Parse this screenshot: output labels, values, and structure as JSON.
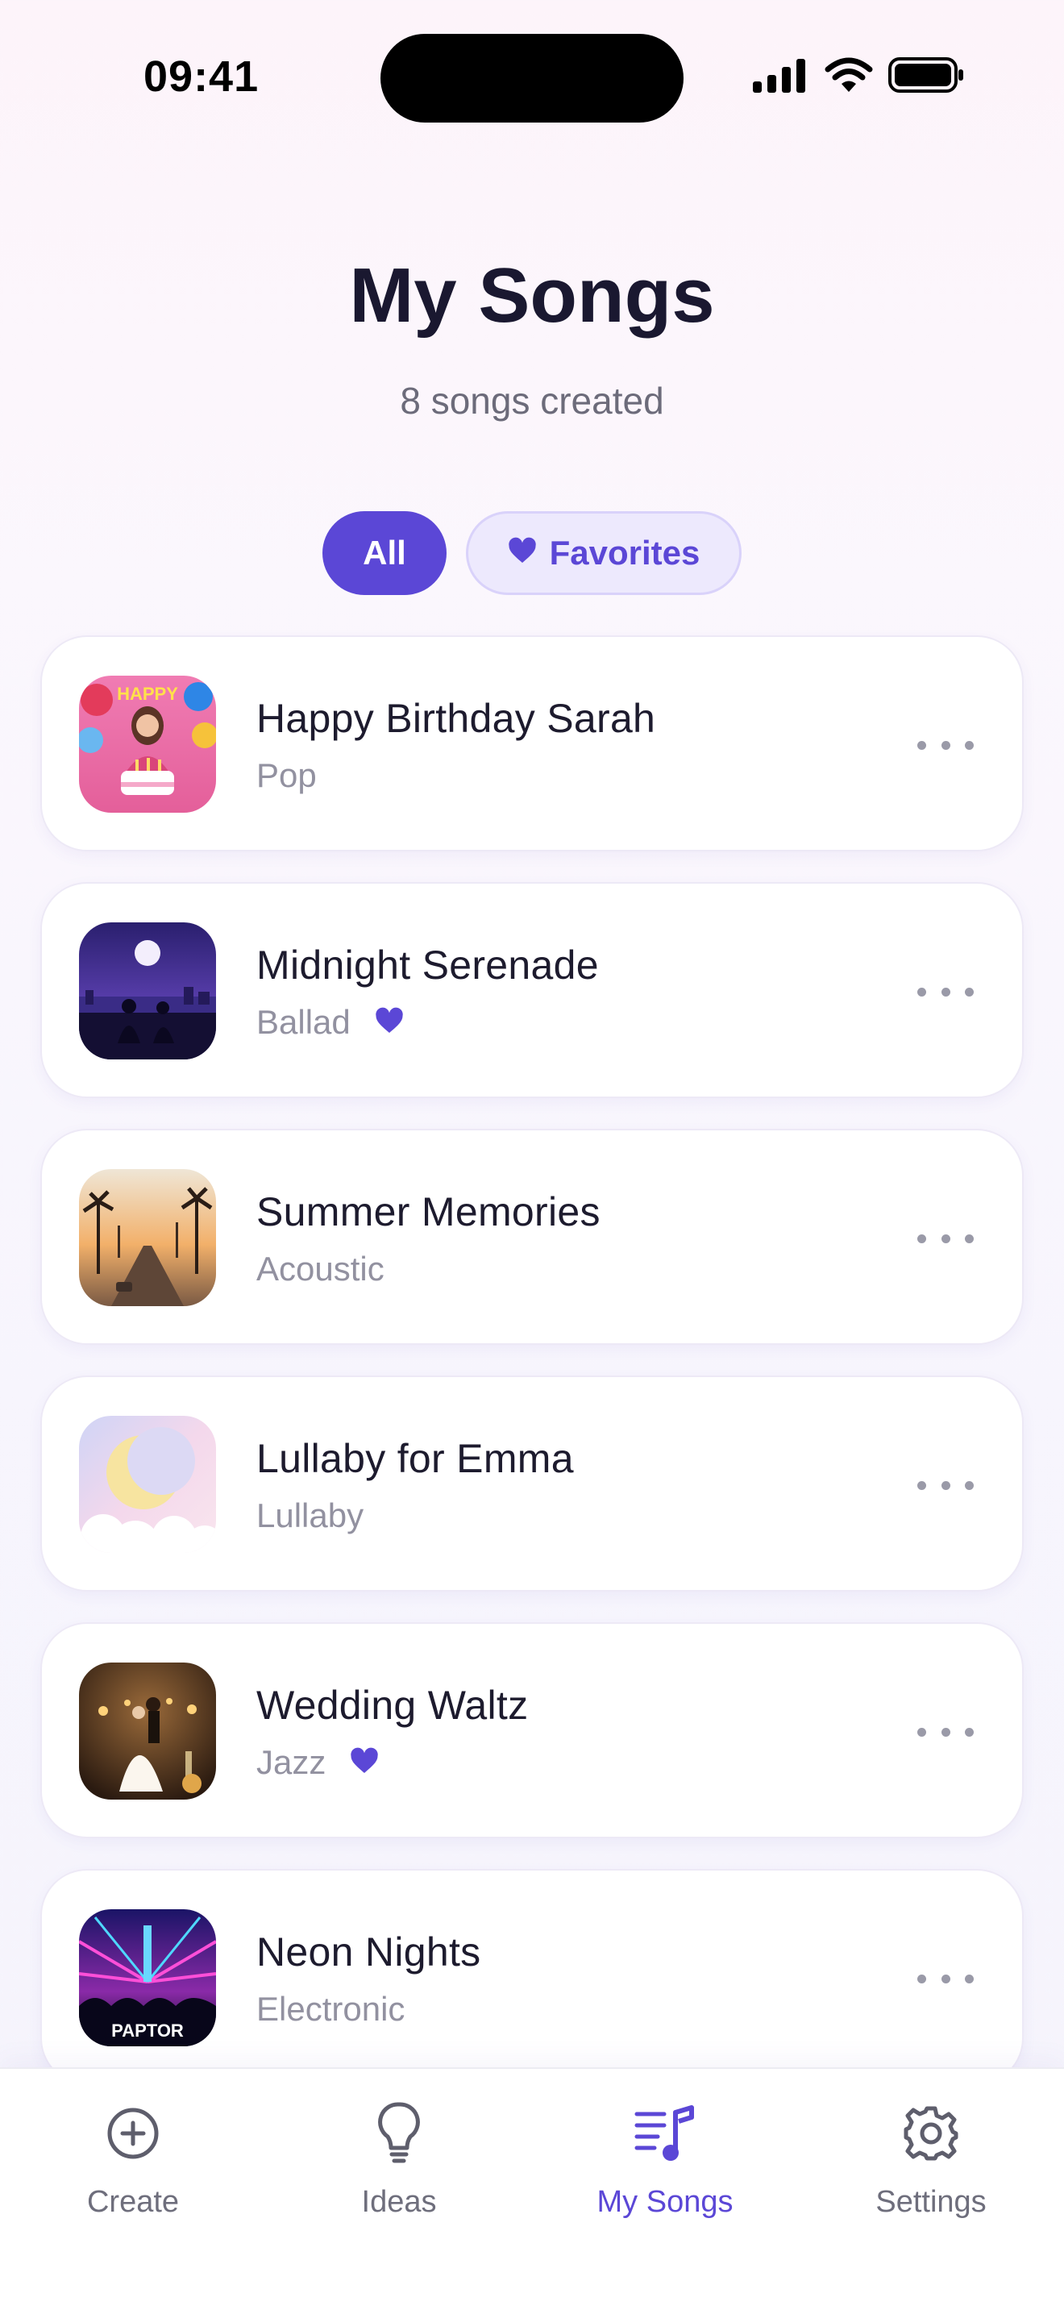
{
  "status_bar": {
    "time": "09:41",
    "icons": [
      "cellular-signal-icon",
      "wifi-icon",
      "battery-icon"
    ]
  },
  "header": {
    "title": "My Songs",
    "subtitle": "8 songs created"
  },
  "filters": {
    "all_label": "All",
    "favorites_label": "Favorites",
    "selected": "All"
  },
  "songs": [
    {
      "title": "Happy Birthday Sarah",
      "genre": "Pop",
      "favorite": false
    },
    {
      "title": "Midnight Serenade",
      "genre": "Ballad",
      "favorite": true
    },
    {
      "title": "Summer Memories",
      "genre": "Acoustic",
      "favorite": false
    },
    {
      "title": "Lullaby for Emma",
      "genre": "Lullaby",
      "favorite": false
    },
    {
      "title": "Wedding Waltz",
      "genre": "Jazz",
      "favorite": true
    },
    {
      "title": "Neon Nights",
      "genre": "Electronic",
      "favorite": false
    }
  ],
  "tabbar": {
    "create": "Create",
    "ideas": "Ideas",
    "my_songs": "My Songs",
    "settings": "Settings",
    "active": "My Songs"
  },
  "colors": {
    "accent": "#5b47d6",
    "favorite_chip_bg": "#ede9fd",
    "muted_text": "#9291a0"
  }
}
